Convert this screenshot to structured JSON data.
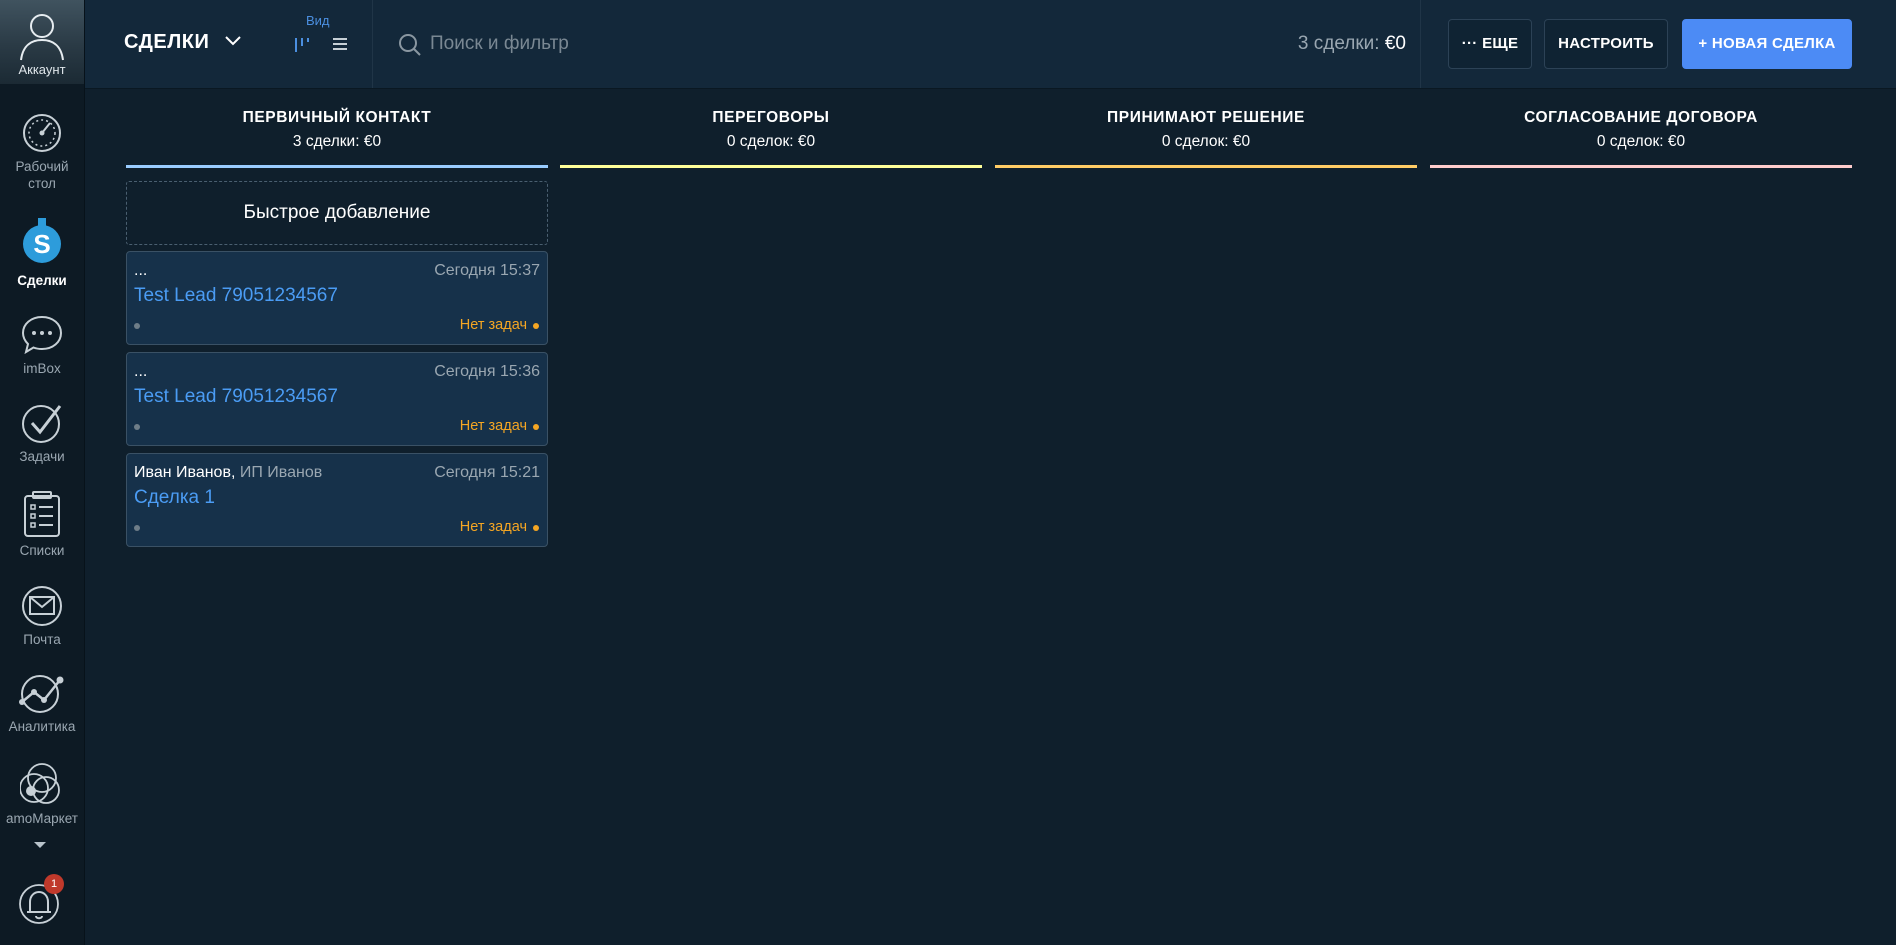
{
  "sidebar": {
    "account_label": "Аккаунт",
    "items": [
      {
        "label": "Рабочий стол",
        "icon": "dashboard-icon"
      },
      {
        "label": "Сделки",
        "icon": "deals-icon",
        "active": true
      },
      {
        "label": "imBox",
        "icon": "chat-icon"
      },
      {
        "label": "Задачи",
        "icon": "tasks-icon"
      },
      {
        "label": "Списки",
        "icon": "lists-icon"
      },
      {
        "label": "Почта",
        "icon": "mail-icon"
      },
      {
        "label": "Аналитика",
        "icon": "analytics-icon"
      },
      {
        "label": "amoМаркет",
        "icon": "market-icon"
      }
    ],
    "notifications_count": "1"
  },
  "header": {
    "title": "СДЕЛКИ",
    "view_label": "Вид",
    "search_placeholder": "Поиск и фильтр",
    "count_prefix": "3 сделки:",
    "count_amount": "€0",
    "more_label": "··· ЕЩЕ",
    "setup_label": "НАСТРОИТЬ",
    "new_deal_label": "+ НОВАЯ СДЕЛКА"
  },
  "colors": {
    "accent": "#4c8bf5",
    "link": "#4b9cf4",
    "warning": "#f5a623",
    "stage_primary": "#99ccff",
    "stage_negotiation": "#ffff99",
    "stage_decision": "#ffcc66",
    "stage_contract": "#ffcccc"
  },
  "pipeline": {
    "quick_add_label": "Быстрое добавление",
    "stages": [
      {
        "title": "ПЕРВИЧНЫЙ КОНТАКТ",
        "summary": "3 сделки: €0",
        "color": "#99ccff"
      },
      {
        "title": "ПЕРЕГОВОРЫ",
        "summary": "0 сделок: €0",
        "color": "#ffff99"
      },
      {
        "title": "ПРИНИМАЮТ РЕШЕНИЕ",
        "summary": "0 сделок: €0",
        "color": "#ffcc66"
      },
      {
        "title": "СОГЛАСОВАНИЕ ДОГОВОРА",
        "summary": "0 сделок: €0",
        "color": "#ffcccc"
      }
    ],
    "cards": [
      {
        "contact": "...",
        "company": "",
        "time": "Сегодня 15:37",
        "name": "Test Lead 79051234567",
        "tasks": "Нет задач"
      },
      {
        "contact": "...",
        "company": "",
        "time": "Сегодня 15:36",
        "name": "Test Lead 79051234567",
        "tasks": "Нет задач"
      },
      {
        "contact": "Иван Иванов,",
        "company": "ИП Иванов",
        "time": "Сегодня 15:21",
        "name": "Сделка 1",
        "tasks": "Нет задач"
      }
    ]
  }
}
